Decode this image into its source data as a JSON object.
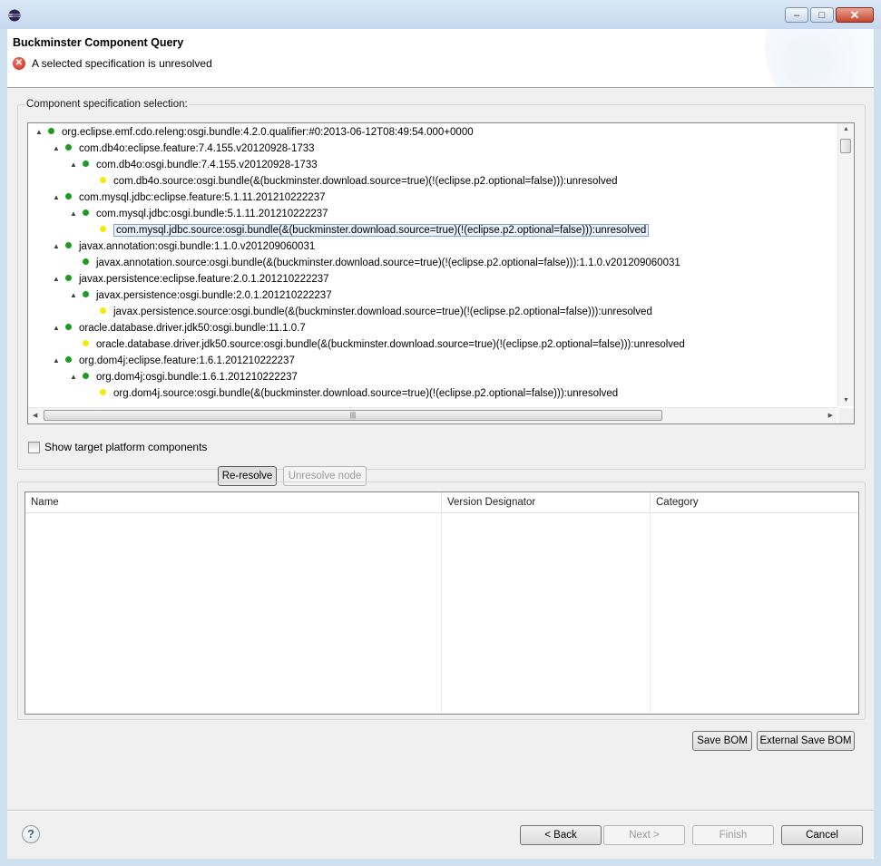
{
  "window": {
    "minimize_glyph": "–",
    "maximize_glyph": "□",
    "close_glyph": "✕"
  },
  "header": {
    "title": "Buckminster Component Query",
    "message": "A selected specification is unresolved",
    "error_glyph": "✕"
  },
  "spec_group": {
    "label": "Component specification selection:",
    "tree": [
      {
        "level": 0,
        "toggle": "▲",
        "dot": "green",
        "label": "org.eclipse.emf.cdo.releng:osgi.bundle:4.2.0.qualifier:#0:2013-06-12T08:49:54.000+0000"
      },
      {
        "level": 1,
        "toggle": "▲",
        "dot": "green",
        "label": "com.db4o:eclipse.feature:7.4.155.v20120928-1733"
      },
      {
        "level": 2,
        "toggle": "▲",
        "dot": "green",
        "label": "com.db4o:osgi.bundle:7.4.155.v20120928-1733"
      },
      {
        "level": 3,
        "toggle": "",
        "dot": "yellow",
        "label": "com.db4o.source:osgi.bundle(&(buckminster.download.source=true)(!(eclipse.p2.optional=false))):unresolved"
      },
      {
        "level": 1,
        "toggle": "▲",
        "dot": "green",
        "label": "com.mysql.jdbc:eclipse.feature:5.1.11.201210222237"
      },
      {
        "level": 2,
        "toggle": "▲",
        "dot": "green",
        "label": "com.mysql.jdbc:osgi.bundle:5.1.11.201210222237"
      },
      {
        "level": 3,
        "toggle": "",
        "dot": "yellow",
        "label": "com.mysql.jdbc.source:osgi.bundle(&(buckminster.download.source=true)(!(eclipse.p2.optional=false))):unresolved",
        "selected": true
      },
      {
        "level": 1,
        "toggle": "▲",
        "dot": "green",
        "label": "javax.annotation:osgi.bundle:1.1.0.v201209060031"
      },
      {
        "level": 2,
        "toggle": "",
        "dot": "green",
        "label": "javax.annotation.source:osgi.bundle(&(buckminster.download.source=true)(!(eclipse.p2.optional=false))):1.1.0.v201209060031"
      },
      {
        "level": 1,
        "toggle": "▲",
        "dot": "green",
        "label": "javax.persistence:eclipse.feature:2.0.1.201210222237"
      },
      {
        "level": 2,
        "toggle": "▲",
        "dot": "green",
        "label": "javax.persistence:osgi.bundle:2.0.1.201210222237"
      },
      {
        "level": 3,
        "toggle": "",
        "dot": "yellow",
        "label": "javax.persistence.source:osgi.bundle(&(buckminster.download.source=true)(!(eclipse.p2.optional=false))):unresolved"
      },
      {
        "level": 1,
        "toggle": "▲",
        "dot": "green",
        "label": "oracle.database.driver.jdk50:osgi.bundle:11.1.0.7"
      },
      {
        "level": 2,
        "toggle": "",
        "dot": "yellow",
        "label": "oracle.database.driver.jdk50.source:osgi.bundle(&(buckminster.download.source=true)(!(eclipse.p2.optional=false))):unresolved"
      },
      {
        "level": 1,
        "toggle": "▲",
        "dot": "green",
        "label": "org.dom4j:eclipse.feature:1.6.1.201210222237"
      },
      {
        "level": 2,
        "toggle": "▲",
        "dot": "green",
        "label": "org.dom4j:osgi.bundle:1.6.1.201210222237"
      },
      {
        "level": 3,
        "toggle": "",
        "dot": "yellow",
        "label": "org.dom4j.source:osgi.bundle(&(buckminster.download.source=true)(!(eclipse.p2.optional=false))):unresolved"
      }
    ],
    "show_target_label": "Show target platform components",
    "show_target_checked": false,
    "reresolve_label": "Re-resolve",
    "unresolve_label": "Unresolve node"
  },
  "bom_table": {
    "columns": [
      "Name",
      "Version Designator",
      "Category"
    ],
    "rows": []
  },
  "bom_buttons": {
    "save_bom": "Save BOM",
    "external_save_bom": "External Save BOM"
  },
  "footer": {
    "help_glyph": "?",
    "back_label": "< Back",
    "next_label": "Next >",
    "finish_label": "Finish",
    "cancel_label": "Cancel"
  },
  "colors": {
    "green_dot": "#1e9c1e",
    "yellow_dot": "#f2ea0e",
    "error_red": "#c8281b",
    "selection_bg": "#e8f1fb"
  }
}
